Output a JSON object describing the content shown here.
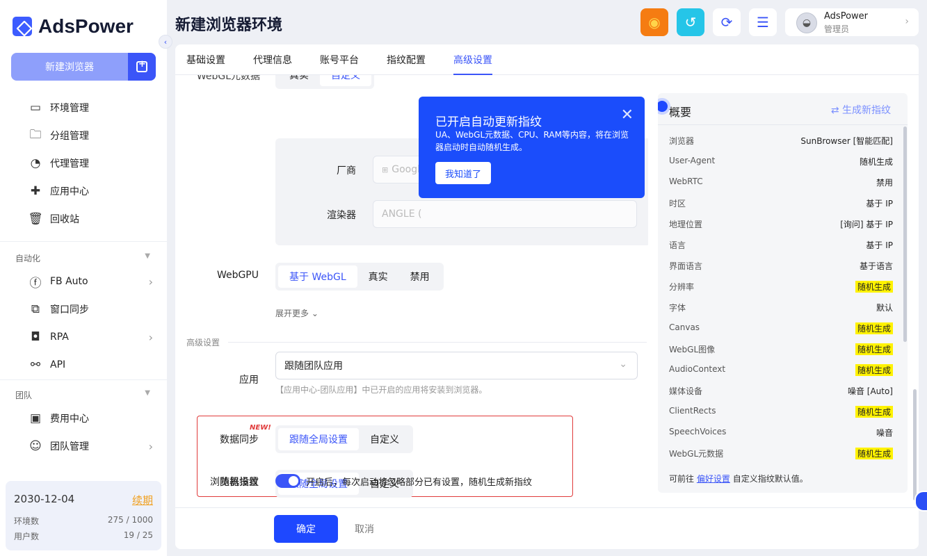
{
  "app": {
    "name": "AdsPower"
  },
  "sidebar": {
    "new_browser": "新建浏览器",
    "items": [
      {
        "label": "环境管理",
        "icon": "browser-window-icon"
      },
      {
        "label": "分组管理",
        "icon": "folder-icon"
      },
      {
        "label": "代理管理",
        "icon": "proxy-globe-icon"
      },
      {
        "label": "应用中心",
        "icon": "puzzle-icon"
      },
      {
        "label": "回收站",
        "icon": "trash-icon"
      }
    ],
    "automation": {
      "title": "自动化",
      "items": [
        {
          "label": "FB Auto",
          "icon": "facebook-icon"
        },
        {
          "label": "窗口同步",
          "icon": "window-sync-icon"
        },
        {
          "label": "RPA",
          "icon": "robot-icon"
        },
        {
          "label": "API",
          "icon": "api-icon"
        }
      ]
    },
    "team": {
      "title": "团队",
      "items": [
        {
          "label": "费用中心",
          "icon": "wallet-icon"
        },
        {
          "label": "团队管理",
          "icon": "team-icon"
        }
      ]
    },
    "plan": {
      "date": "2030-12-04",
      "renew": "续期",
      "env_label": "环境数",
      "env_value": "275 / 1000",
      "user_label": "用户数",
      "user_value": "19 / 25"
    }
  },
  "header": {
    "title": "新建浏览器环境",
    "user": {
      "name": "AdsPower",
      "role": "管理员"
    }
  },
  "tabs": [
    "基础设置",
    "代理信息",
    "账号平台",
    "指纹配置",
    "高级设置"
  ],
  "form": {
    "webgl_meta_label": "WebGL元数据",
    "webgl_meta_opts": [
      "真实",
      "自定义"
    ],
    "vendor_label": "厂商",
    "vendor_value": "Google",
    "renderer_label": "渲染器",
    "renderer_value": "ANGLE (",
    "webgpu_label": "WebGPU",
    "webgpu_opts": [
      "基于 WebGL",
      "真实",
      "禁用"
    ],
    "expand_more": "展开更多",
    "advanced_section": "高级设置",
    "app_label": "应用",
    "app_value": "跟随团队应用",
    "app_hint": "【应用中心-团队应用】中已开启的应用将安装到浏览器。",
    "data_sync_label": "数据同步",
    "data_sync_opts": [
      "跟随全局设置",
      "自定义"
    ],
    "browser_settings_label": "浏览器设置",
    "new_tag": "NEW!",
    "browser_settings_opts": [
      "跟随全局设置",
      "自定义"
    ],
    "random_fp_label": "随机指纹",
    "random_fp_text": "开启后，每次启动将忽略部分已有设置，随机生成新指纹"
  },
  "popup": {
    "title": "已开启自动更新指纹",
    "body": "UA、WebGL元数据、CPU、RAM等内容，将在浏览器启动时自动随机生成。",
    "button": "我知道了"
  },
  "overview": {
    "title": "概要",
    "generate": "生成新指纹",
    "rows": [
      {
        "k": "浏览器",
        "v": "SunBrowser [智能匹配]",
        "hl": false
      },
      {
        "k": "User-Agent",
        "v": "随机生成",
        "hl": false
      },
      {
        "k": "WebRTC",
        "v": "禁用",
        "hl": false
      },
      {
        "k": "时区",
        "v": "基于 IP",
        "hl": false
      },
      {
        "k": "地理位置",
        "v": "[询问] 基于 IP",
        "hl": false
      },
      {
        "k": "语言",
        "v": "基于 IP",
        "hl": false
      },
      {
        "k": "界面语言",
        "v": "基于语言",
        "hl": false
      },
      {
        "k": "分辨率",
        "v": "随机生成",
        "hl": true
      },
      {
        "k": "字体",
        "v": "默认",
        "hl": false
      },
      {
        "k": "Canvas",
        "v": "随机生成",
        "hl": true
      },
      {
        "k": "WebGL图像",
        "v": "随机生成",
        "hl": true
      },
      {
        "k": "AudioContext",
        "v": "随机生成",
        "hl": true
      },
      {
        "k": "媒体设备",
        "v": "噪音 [Auto]",
        "hl": false
      },
      {
        "k": "ClientRects",
        "v": "随机生成",
        "hl": true
      },
      {
        "k": "SpeechVoices",
        "v": "噪音",
        "hl": false
      },
      {
        "k": "WebGL元数据",
        "v": "随机生成",
        "hl": true
      }
    ],
    "foot_pre": "可前往",
    "foot_link": "偏好设置",
    "foot_post": "自定义指纹默认值。"
  },
  "footer": {
    "ok": "确定",
    "cancel": "取消"
  },
  "colors": {
    "accent": "#3b55f8",
    "popup": "#1b4dfb",
    "highlight": "#fff200",
    "alert": "#e03a3a"
  }
}
